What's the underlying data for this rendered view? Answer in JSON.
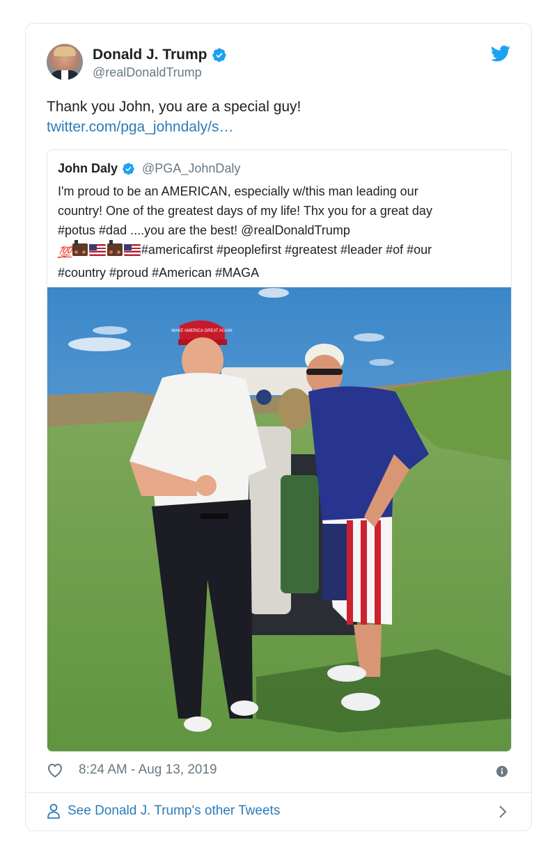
{
  "author": {
    "display_name": "Donald J. Trump",
    "handle": "@realDonaldTrump",
    "verified": true
  },
  "tweet": {
    "text": "Thank you John, you are a special guy!",
    "link_text": "twitter.com/pga_johndaly/s…"
  },
  "quoted": {
    "display_name": "John Daly",
    "handle": "@PGA_JohnDaly",
    "verified": true,
    "lines": [
      "I'm proud to be an AMERICAN, especially w/this man leading our",
      "country! One of the greatest days of my life! Thx you for a great day",
      "#potus #dad ....you are the best! @realDonaldTrump",
      "#americafirst #peoplefirst #greatest #leader #of #our",
      "#country #proud #American #MAGA"
    ],
    "emoji_100": "💯",
    "photo_hat_text": "MAKE AMERICA GREAT AGAIN"
  },
  "footer": {
    "timestamp": "8:24 AM - Aug 13, 2019",
    "see_more": "See Donald J. Trump's other Tweets"
  },
  "colors": {
    "link": "#2b7bb9",
    "verified": "#1da1f2",
    "muted": "#697882",
    "border": "#e1e8ed"
  },
  "icons": [
    "twitter-bird-icon",
    "verified-icon",
    "heart-icon",
    "info-icon",
    "person-icon",
    "chevron-right-icon"
  ]
}
